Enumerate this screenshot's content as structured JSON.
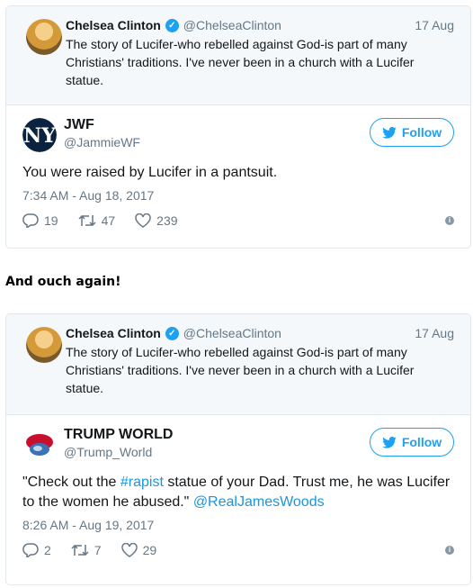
{
  "tweet1": {
    "quoted": {
      "name": "Chelsea Clinton",
      "handle": "@ChelseaClinton",
      "date": "17 Aug",
      "text": "The story of Lucifer-who rebelled against God-is part of many Christians' traditions. I've never been in a church with a Lucifer statue."
    },
    "reply": {
      "name": "JWF",
      "handle": "@JammieWF",
      "follow_label": "Follow",
      "text": "You were raised by Lucifer in a pantsuit.",
      "timestamp": "7:34 AM - Aug 18, 2017",
      "replies": "19",
      "retweets": "47",
      "likes": "239"
    }
  },
  "interlude": "And ouch again!",
  "tweet2": {
    "quoted": {
      "name": "Chelsea Clinton",
      "handle": "@ChelseaClinton",
      "date": "17 Aug",
      "text": "The story of Lucifer-who rebelled against God-is part of many Christians' traditions. I've never been in a church with a Lucifer statue."
    },
    "reply": {
      "name": "TRUMP WORLD",
      "handle": "@Trump_World",
      "follow_label": "Follow",
      "text_part1": "\"Check out the ",
      "hashtag": "#rapist",
      "text_part2": " statue of your Dad. Trust me, he was Lucifer to the women he abused.\" ",
      "mention": "@RealJamesWoods",
      "timestamp": "8:26 AM - Aug 19, 2017",
      "replies": "2",
      "retweets": "7",
      "likes": "29"
    }
  },
  "colors": {
    "accent": "#1da1f2",
    "link": "#1b95e0",
    "muted": "#657786",
    "quoted_bg": "#f5f8fa"
  }
}
